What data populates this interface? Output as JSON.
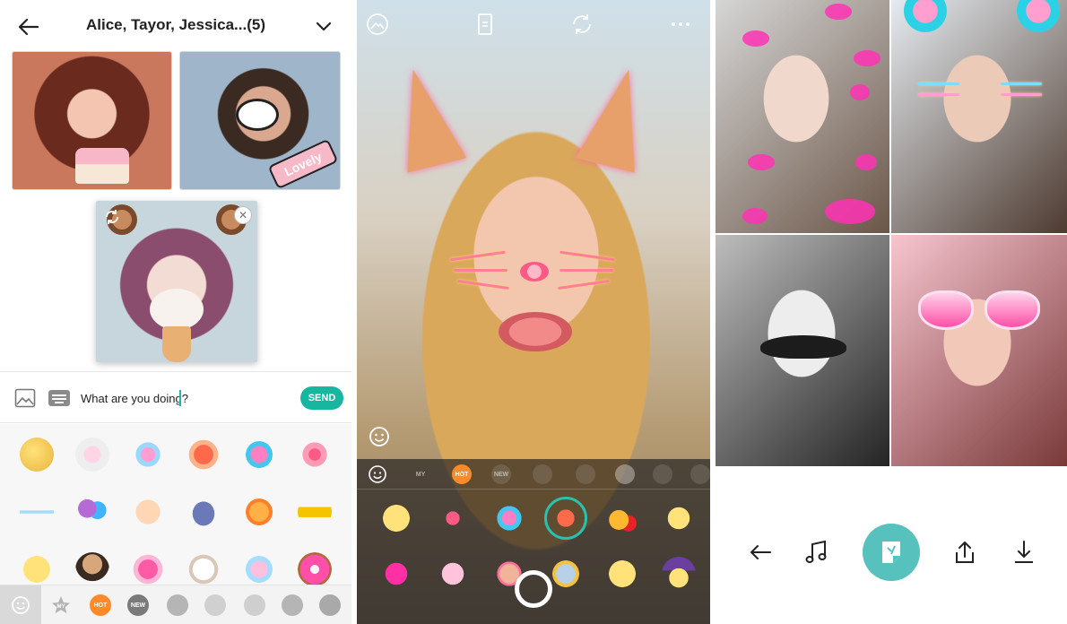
{
  "chat": {
    "title": "Alice, Tayor, Jessica...(5)",
    "tile_sticker_text": "Lovely",
    "message_value": "What are you doing?",
    "send_label": "SEND",
    "tabs": [
      {
        "id": "my",
        "label": "MY"
      },
      {
        "id": "hot",
        "label": "HOT"
      },
      {
        "id": "new",
        "label": "NEW"
      }
    ],
    "stickers": [
      "twin-faces",
      "bunny-ears",
      "cat-ears",
      "fox-face",
      "mouse-ears",
      "cat-whiskers",
      "sparkle-line",
      "balloons",
      "thumbs-up",
      "whale",
      "autumn-leaf",
      "gold-crown",
      "heart-eyes",
      "beard",
      "pink-hearts",
      "puppy",
      "glitter-ball",
      "donut"
    ]
  },
  "camera": {
    "categories": [
      {
        "id": "my",
        "label": "MY"
      },
      {
        "id": "hot",
        "label": "HOT"
      },
      {
        "id": "new",
        "label": "NEW"
      }
    ],
    "filters": [
      "twin-faces",
      "cat-whiskers",
      "mouse-ears",
      "fox-glitter",
      "pineapple",
      "heart-glasses",
      "kiss-lips",
      "bow-dots",
      "deer-antlers",
      "cat-moon",
      "heart-eyes",
      "witch-hat"
    ],
    "selected_filter": "fox-glitter"
  },
  "colors": {
    "accent": "#17b6a0",
    "hot": "#ff8a2a",
    "shot_button": "#56c1bd"
  }
}
